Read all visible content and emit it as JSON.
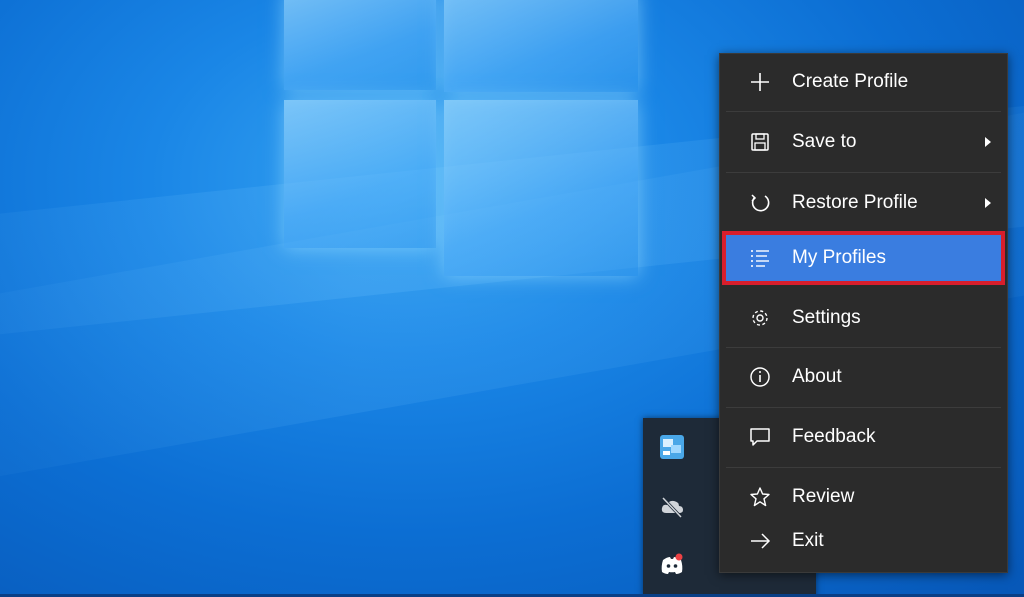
{
  "menu": {
    "items": [
      {
        "id": "create",
        "label": "Create Profile",
        "icon": "plus-icon",
        "submenu": false
      },
      {
        "id": "save",
        "label": "Save to",
        "icon": "floppy-disk-icon",
        "submenu": true
      },
      {
        "id": "restore",
        "label": "Restore Profile",
        "icon": "restore-icon",
        "submenu": true
      },
      {
        "id": "profiles",
        "label": "My Profiles",
        "icon": "list-icon",
        "submenu": false,
        "highlighted": true
      },
      {
        "id": "settings",
        "label": "Settings",
        "icon": "gear-icon",
        "submenu": false
      },
      {
        "id": "about",
        "label": "About",
        "icon": "info-icon",
        "submenu": false
      },
      {
        "id": "feedback",
        "label": "Feedback",
        "icon": "speech-bubble-icon",
        "submenu": false
      },
      {
        "id": "review",
        "label": "Review",
        "icon": "star-icon",
        "submenu": false
      },
      {
        "id": "exit",
        "label": "Exit",
        "icon": "arrow-right-icon",
        "submenu": false
      }
    ]
  },
  "tray": {
    "icons": [
      "app-icon",
      "cloud-offline-icon",
      "discord-icon"
    ]
  },
  "colors": {
    "menu_background": "#2b2b2b",
    "highlight": "#3a7de0",
    "highlight_border": "#d81e2c",
    "desktop_blue": "#0c6ed3"
  }
}
